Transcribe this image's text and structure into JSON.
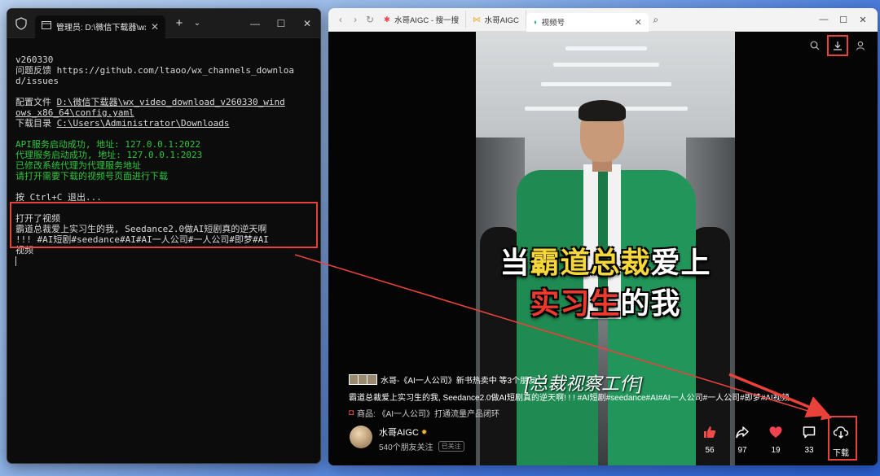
{
  "terminal": {
    "tab_title": "管理员: D:\\微信下载器\\wx_vide",
    "lines": [
      {
        "text": "v260330",
        "style": "normal"
      },
      {
        "text": "问题反馈 https://github.com/ltaoo/wx_channels_downloa",
        "style": "normal"
      },
      {
        "text": "d/issues",
        "style": "normal"
      },
      {
        "text": "",
        "style": "normal"
      },
      {
        "text": "配置文件 D:\\微信下载器\\wx_video_download_v260330_wind",
        "style": "link"
      },
      {
        "text": "ows_x86_64\\config.yaml",
        "style": "link"
      },
      {
        "text": "下载目录 C:\\Users\\Administrator\\Downloads",
        "style": "link"
      },
      {
        "text": "",
        "style": "normal"
      },
      {
        "text": "API服务启动成功, 地址: 127.0.0.1:2022",
        "style": "green"
      },
      {
        "text": "代理服务启动成功, 地址: 127.0.0.1:2023",
        "style": "green"
      },
      {
        "text": "已修改系统代理为代理服务地址",
        "style": "green"
      },
      {
        "text": "请打开需要下载的视频号页面进行下载",
        "style": "green"
      },
      {
        "text": "",
        "style": "normal"
      },
      {
        "text": "按 Ctrl+C 退出...",
        "style": "normal"
      },
      {
        "text": "",
        "style": "normal"
      },
      {
        "text": "打开了视频",
        "style": "normal"
      },
      {
        "text": "霸道总裁爱上实习生的我, Seedance2.0做AI短剧真的逆天啊",
        "style": "normal"
      },
      {
        "text": "!!! #AI短剧#seedance#AI#AI一人公司#一人公司#即梦#AI",
        "style": "normal"
      },
      {
        "text": "视频",
        "style": "normal"
      }
    ]
  },
  "browser": {
    "tabs": [
      {
        "label": "水哥AIGC - 搜一搜"
      },
      {
        "label": "水哥AIGC"
      },
      {
        "label": "视频号"
      }
    ],
    "overlay": {
      "line1_a": "当",
      "line1_b": "霸道总裁",
      "line1_c": "爱上",
      "line2_a": "实习生",
      "line2_b": "的我",
      "sub": "[总裁视察工作]"
    },
    "viewers_text": "水哥-《AI一人公司》新书热卖中 等3个朋友",
    "description": "霸道总裁爱上实习生的我, Seedance2.0做AI短剧真的逆天啊! ! ! #AI短剧#seedance#AI#AI一人公司#一人公司#即梦#AI视频",
    "product": "商品: 《AI一人公司》打通流量产品闭环",
    "author": "水哥AIGC",
    "friends": "540个朋友关注",
    "followed": "已关注",
    "actions": {
      "like": "56",
      "share": "97",
      "heart": "19",
      "comment": "33",
      "download": "下载"
    }
  },
  "colors": {
    "highlight_red": "#e8423b",
    "terminal_green": "#2fc73e"
  }
}
